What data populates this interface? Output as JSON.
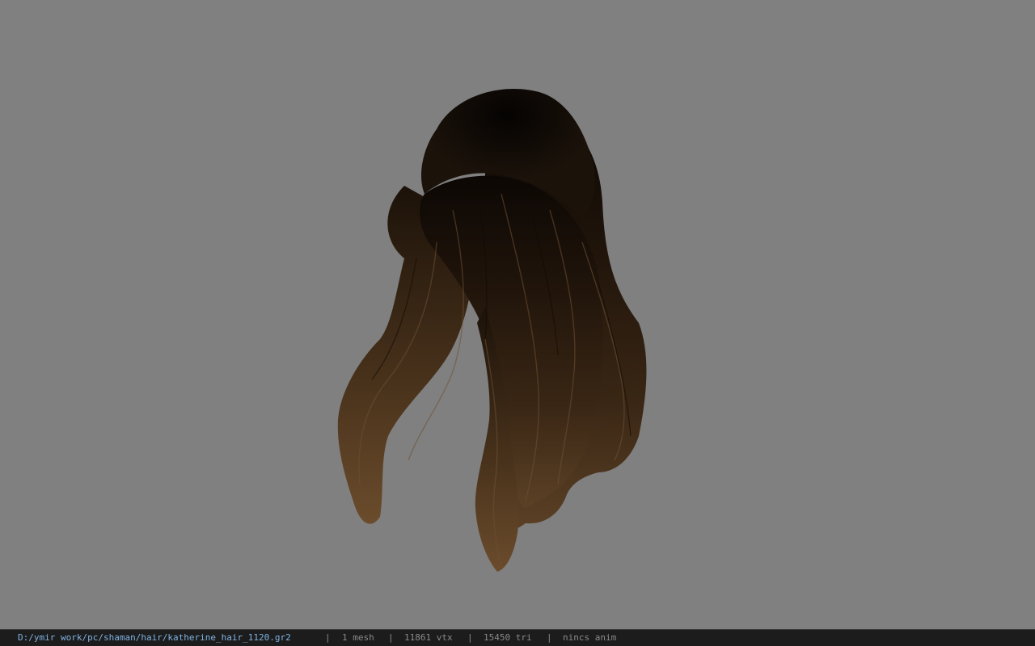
{
  "viewport": {
    "background": "#808080",
    "model": "hair-mesh"
  },
  "status_bar": {
    "file_path": "D:/ymir work/pc/shaman/hair/katherine_hair_1120.gr2",
    "separator": "|",
    "mesh_count": "1 mesh",
    "vertex_count": "11861 vtx",
    "triangle_count": "15450 tri",
    "anim_status": "nincs anim",
    "path_color": "#7fb2e0"
  }
}
